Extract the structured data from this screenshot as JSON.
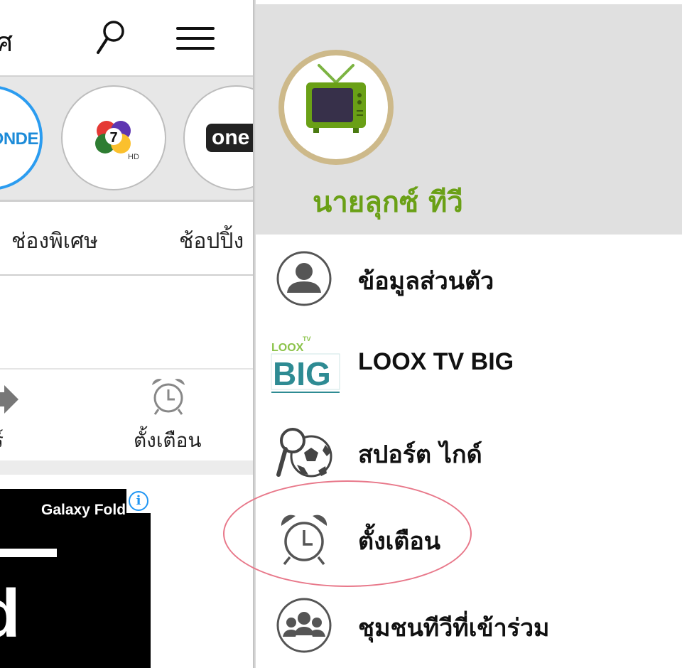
{
  "topbar": {
    "title_fragment": "ศ",
    "search_icon": "search-icon",
    "menu_icon": "hamburger-menu-icon"
  },
  "channels": [
    {
      "label": "ONDE",
      "active": true
    },
    {
      "label": "7",
      "active": false
    },
    {
      "label": "one",
      "active": false
    }
  ],
  "tabs": [
    "ช่องพิเศษ",
    "ช้อปปิ้ง"
  ],
  "actions": {
    "share_label": "ร์",
    "alarm_label": "ตั้งเตือน"
  },
  "ad": {
    "brand": "Galaxy Fold",
    "letter": "d",
    "info_icon": "info-icon"
  },
  "drawer": {
    "user_name": "นายลุกซ์ ทีวี",
    "avatar_icon": "tv-icon",
    "items": [
      {
        "label": "ข้อมูลส่วนตัว",
        "icon": "profile-icon"
      },
      {
        "label": "LOOX TV BIG",
        "icon": "loox-tv-big-logo"
      },
      {
        "label": "สปอร์ต ไกด์",
        "icon": "sport-guide-icon"
      },
      {
        "label": "ตั้งเตือน",
        "icon": "alarm-clock-icon"
      },
      {
        "label": "ชุมชนทีวีที่เข้าร่วม",
        "icon": "community-icon"
      }
    ]
  },
  "colors": {
    "accent_green": "#6aa016",
    "drawer_header_bg": "#e0e0e0",
    "highlight_ring": "#e8788a",
    "active_channel_ring": "#2b9cf0"
  }
}
